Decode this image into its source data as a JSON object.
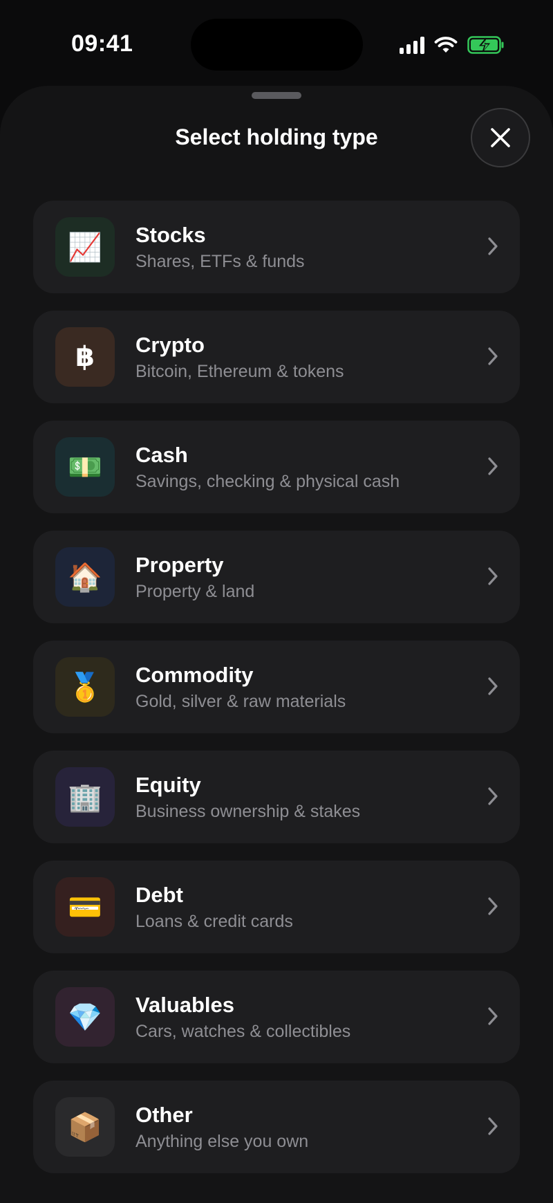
{
  "status_bar": {
    "time": "09:41"
  },
  "sheet": {
    "title": "Select holding type"
  },
  "holdings": [
    {
      "title": "Stocks",
      "subtitle": "Shares, ETFs & funds",
      "icon": "📈",
      "icon_name": "chart-increasing-icon",
      "icon_bg": "#1d2d24"
    },
    {
      "title": "Crypto",
      "subtitle": "Bitcoin, Ethereum & tokens",
      "icon": "฿",
      "icon_name": "bitcoin-icon",
      "icon_bg": "#3a2a22"
    },
    {
      "title": "Cash",
      "subtitle": "Savings, checking & physical cash",
      "icon": "💵",
      "icon_name": "banknote-icon",
      "icon_bg": "#1a2e32"
    },
    {
      "title": "Property",
      "subtitle": "Property & land",
      "icon": "🏠",
      "icon_name": "house-icon",
      "icon_bg": "#1d2538"
    },
    {
      "title": "Commodity",
      "subtitle": "Gold, silver & raw materials",
      "icon": "🥇",
      "icon_name": "gold-medal-icon",
      "icon_bg": "#2e2a1c"
    },
    {
      "title": "Equity",
      "subtitle": "Business ownership & stakes",
      "icon": "🏢",
      "icon_name": "office-building-icon",
      "icon_bg": "#27233a"
    },
    {
      "title": "Debt",
      "subtitle": "Loans & credit cards",
      "icon": "💳",
      "icon_name": "credit-card-icon",
      "icon_bg": "#35201f"
    },
    {
      "title": "Valuables",
      "subtitle": "Cars, watches & collectibles",
      "icon": "💎",
      "icon_name": "gem-icon",
      "icon_bg": "#322330"
    },
    {
      "title": "Other",
      "subtitle": "Anything else you own",
      "icon": "📦",
      "icon_name": "package-icon",
      "icon_bg": "#2a2a2c"
    }
  ]
}
